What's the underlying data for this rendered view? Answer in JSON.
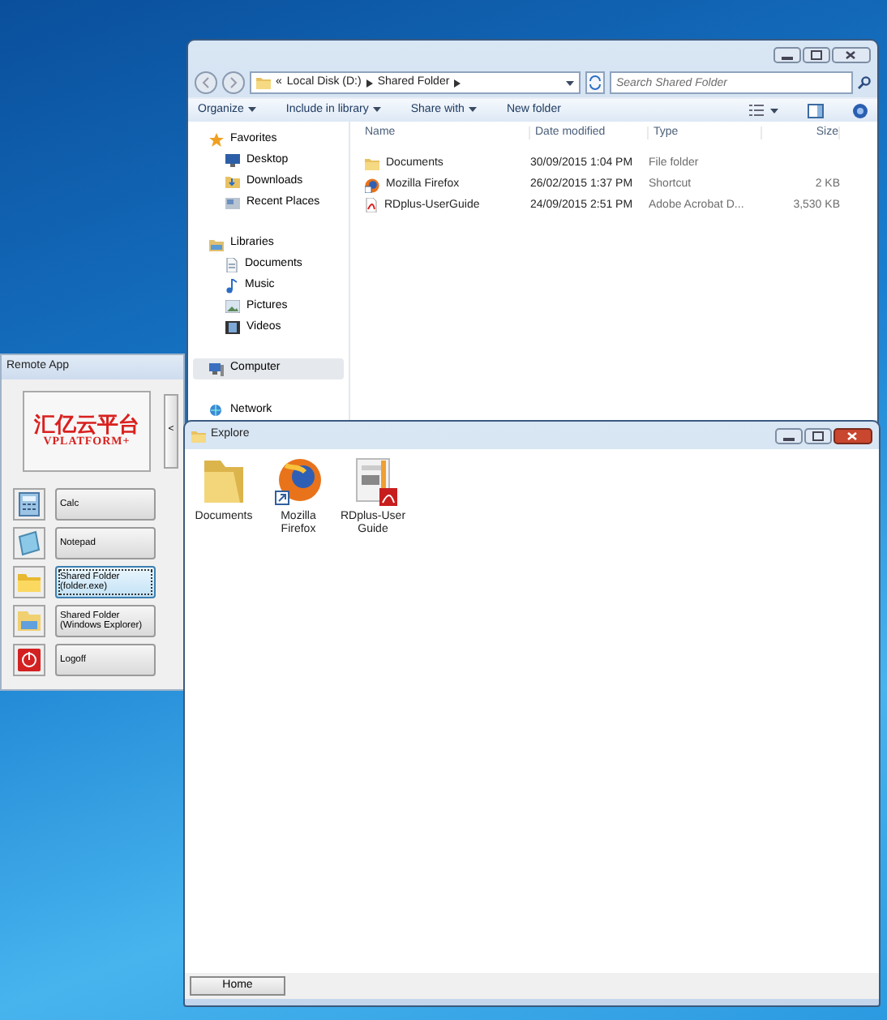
{
  "explorer_window": {
    "active": false,
    "address": {
      "overflow_mark": "«",
      "crumbs": [
        "Local Disk (D:)",
        "Shared Folder"
      ]
    },
    "search": {
      "placeholder": "Search Shared Folder"
    },
    "toolbar": [
      {
        "label": "Organize",
        "dropdown": true
      },
      {
        "label": "Include in library",
        "dropdown": true
      },
      {
        "label": "Share with",
        "dropdown": true
      },
      {
        "label": "New folder",
        "dropdown": false
      }
    ],
    "nav": [
      {
        "label": "Favorites",
        "selected": false,
        "children": [
          {
            "label": "Desktop",
            "selected": false
          },
          {
            "label": "Downloads",
            "selected": false
          },
          {
            "label": "Recent Places",
            "selected": false
          }
        ]
      },
      {
        "label": "Libraries",
        "selected": false,
        "children": [
          {
            "label": "Documents",
            "selected": false
          },
          {
            "label": "Music",
            "selected": false
          },
          {
            "label": "Pictures",
            "selected": false
          },
          {
            "label": "Videos",
            "selected": false
          }
        ]
      },
      {
        "label": "Computer",
        "selected": true
      },
      {
        "label": "Network",
        "selected": false
      }
    ],
    "columns": [
      "Name",
      "Date modified",
      "Type",
      "Size"
    ],
    "rows": [
      {
        "kind": "folder",
        "cells": [
          "Documents",
          "30/09/2015 1:04 PM",
          "File folder",
          ""
        ]
      },
      {
        "kind": "shortcut",
        "cells": [
          "Mozilla Firefox",
          "26/02/2015 1:37 PM",
          "Shortcut",
          "2 KB"
        ]
      },
      {
        "kind": "pdf",
        "cells": [
          "RDplus-UserGuide",
          "24/09/2015 2:51 PM",
          "Adobe Acrobat D...",
          "3,530 KB"
        ]
      }
    ]
  },
  "remote_app": {
    "title": "Remote App",
    "logo": {
      "name": "汇亿云平台",
      "tagline": "VPLATFORM+"
    },
    "collapse": "<",
    "apps": [
      {
        "kind": "calc",
        "label": "Calc",
        "focused": false
      },
      {
        "kind": "notepad",
        "label": "Notepad",
        "focused": false
      },
      {
        "kind": "folder",
        "label": "Shared Folder (folder.exe)",
        "focused": true
      },
      {
        "kind": "explorer",
        "label": "Shared Folder (Windows Explorer)",
        "focused": false
      },
      {
        "kind": "logoff",
        "label": "Logoff",
        "focused": false
      }
    ]
  },
  "explore_window": {
    "title": "Explore",
    "active": true,
    "items": [
      {
        "kind": "folder",
        "label": "Documents"
      },
      {
        "kind": "shortcut",
        "label": "Mozilla Firefox"
      },
      {
        "kind": "pdf",
        "label": "RDplus-User Guide"
      }
    ],
    "home_button": "Home"
  }
}
